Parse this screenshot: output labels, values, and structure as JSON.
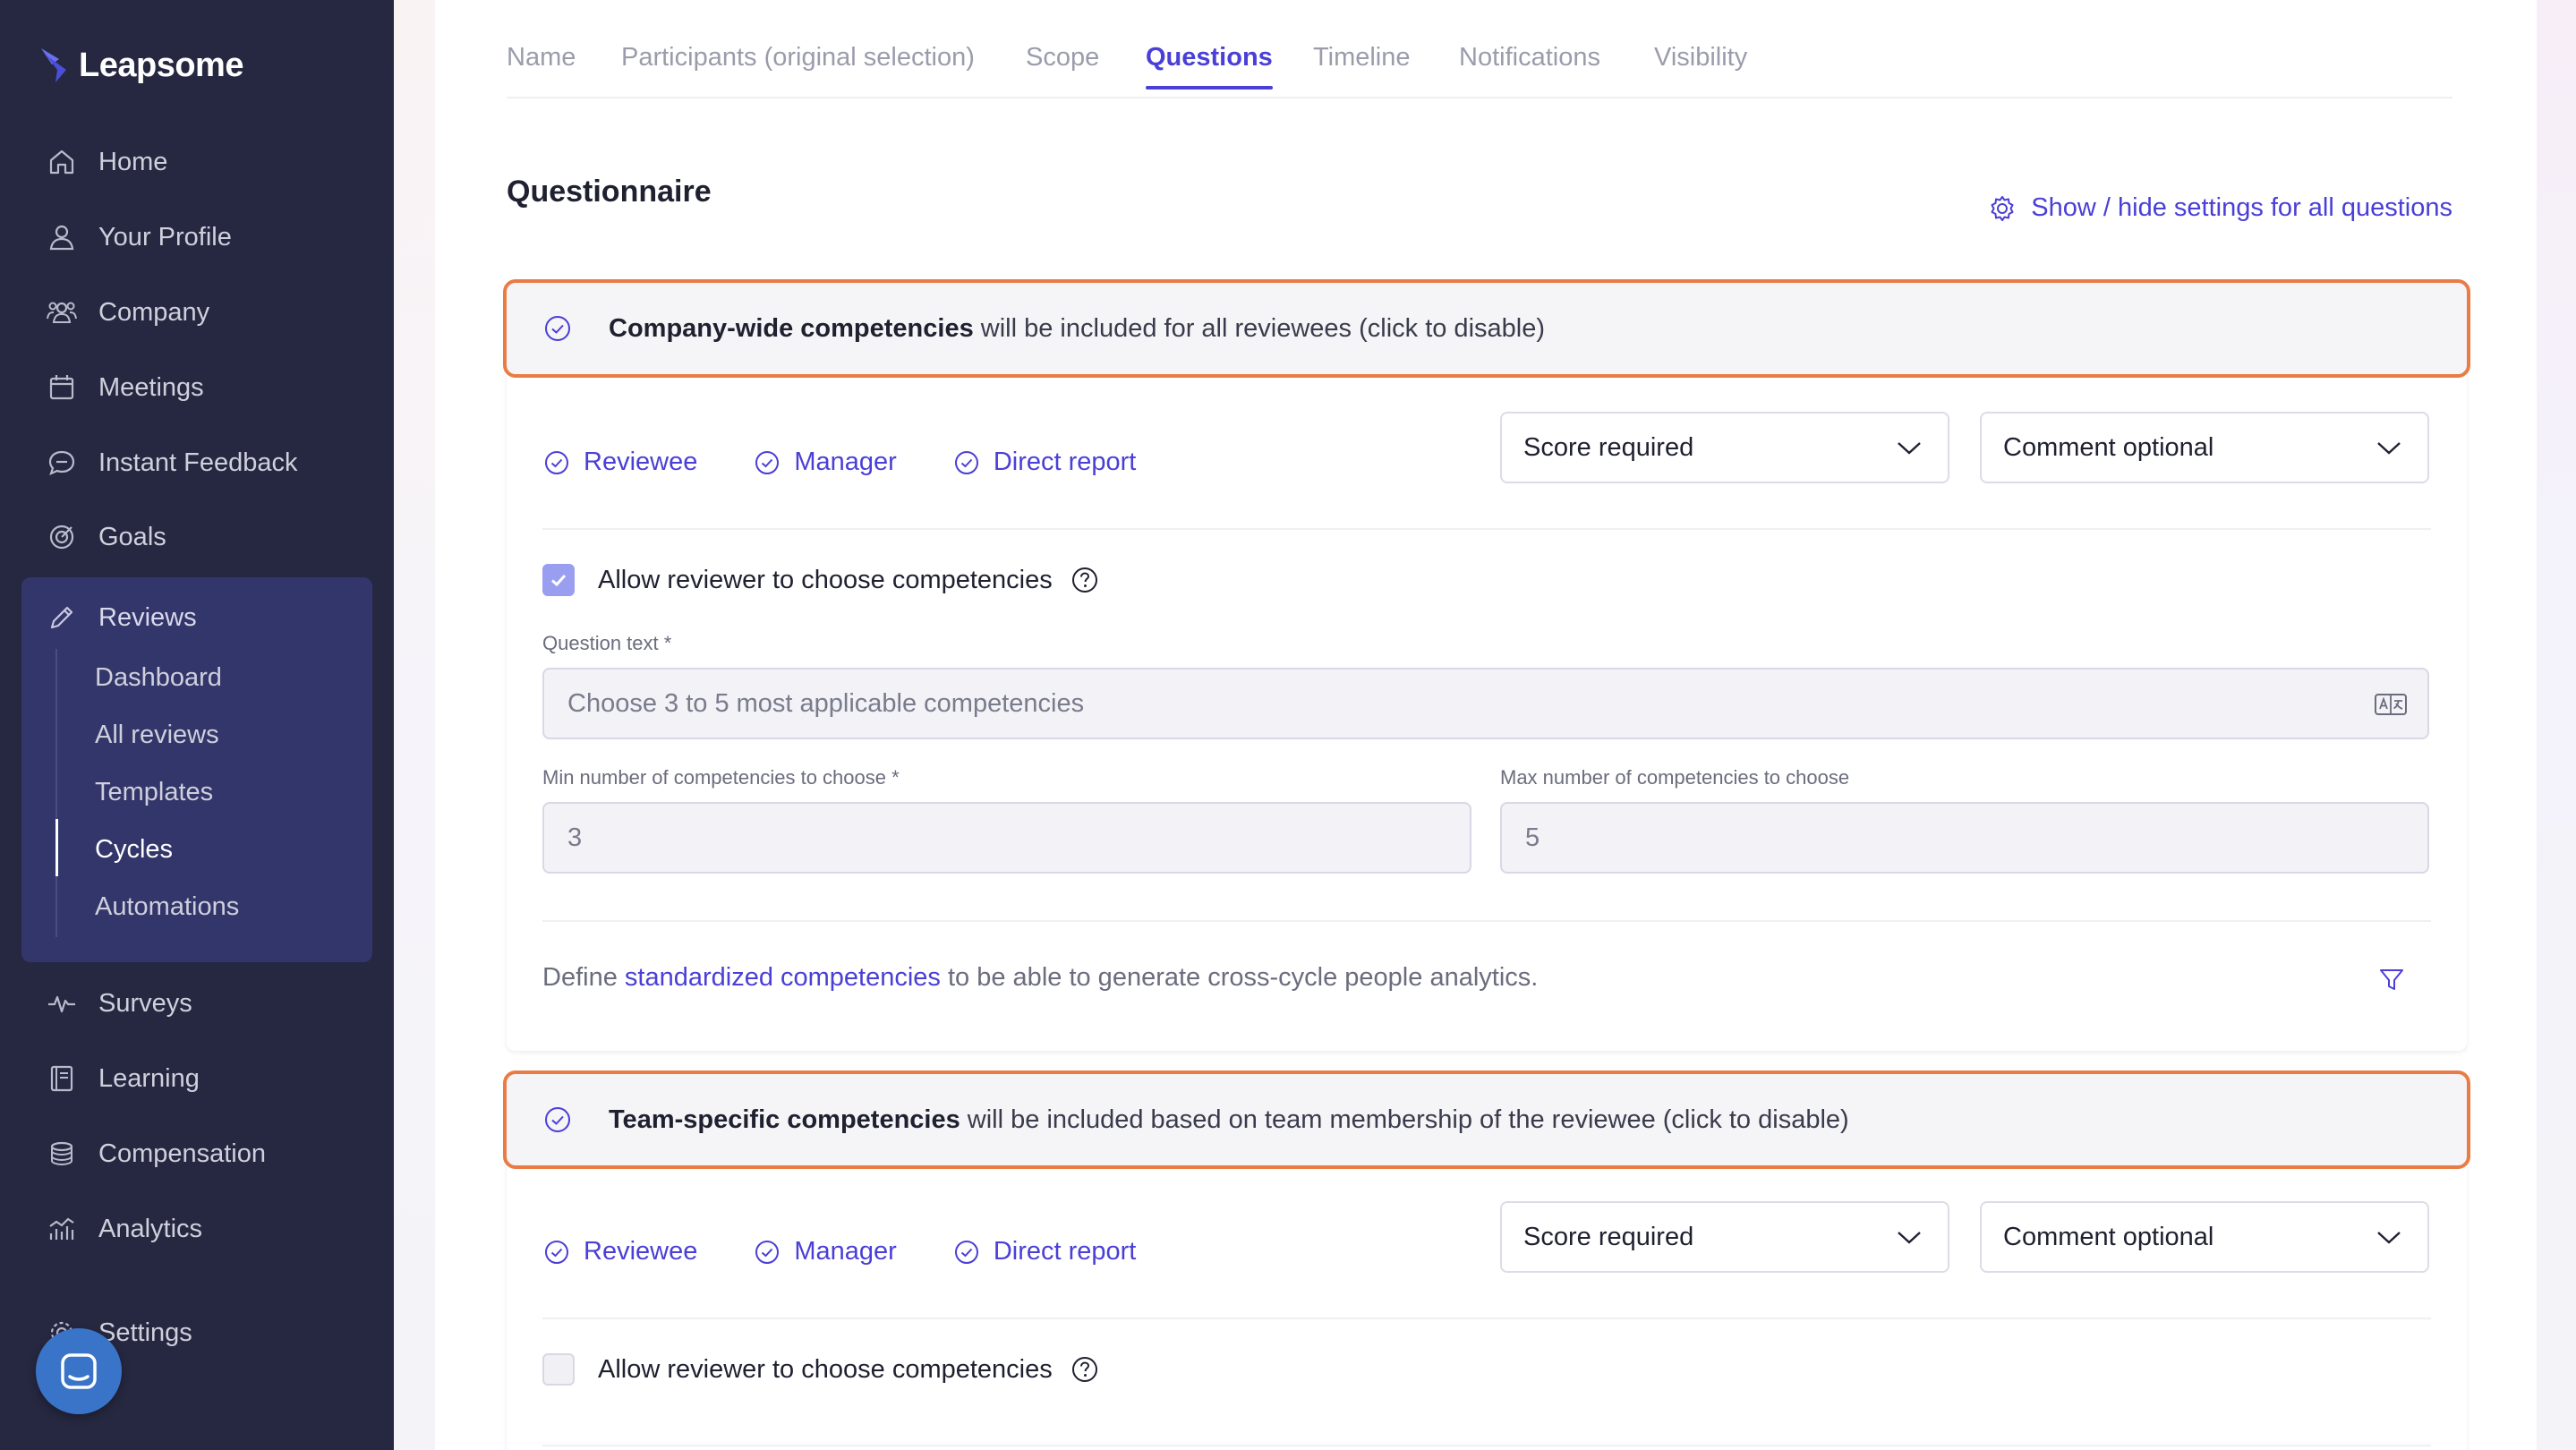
{
  "app": {
    "name": "Leapsome"
  },
  "sidebar": {
    "items": [
      {
        "label": "Home",
        "icon": "home-icon"
      },
      {
        "label": "Your Profile",
        "icon": "user-icon"
      },
      {
        "label": "Company",
        "icon": "company-icon"
      },
      {
        "label": "Meetings",
        "icon": "calendar-icon"
      },
      {
        "label": "Instant Feedback",
        "icon": "chat-icon"
      },
      {
        "label": "Goals",
        "icon": "target-icon"
      },
      {
        "label": "Reviews",
        "icon": "pencil-icon"
      },
      {
        "label": "Surveys",
        "icon": "pulse-icon"
      },
      {
        "label": "Learning",
        "icon": "book-icon"
      },
      {
        "label": "Compensation",
        "icon": "coins-icon"
      },
      {
        "label": "Analytics",
        "icon": "analytics-icon"
      },
      {
        "label": "Settings",
        "icon": "gear-icon"
      }
    ],
    "reviews_sub": [
      {
        "label": "Dashboard"
      },
      {
        "label": "All reviews"
      },
      {
        "label": "Templates"
      },
      {
        "label": "Cycles"
      },
      {
        "label": "Automations"
      }
    ],
    "active_sub": "Cycles"
  },
  "tabs": [
    {
      "label": "Name"
    },
    {
      "label": "Participants (original selection)"
    },
    {
      "label": "Scope"
    },
    {
      "label": "Questions"
    },
    {
      "label": "Timeline"
    },
    {
      "label": "Notifications"
    },
    {
      "label": "Visibility"
    }
  ],
  "active_tab": "Questions",
  "section_title": "Questionnaire",
  "show_hide_label": "Show / hide settings for all questions",
  "blocks": [
    {
      "banner_bold": "Company-wide competencies",
      "banner_rest": "will be included for all reviewees (click to disable)",
      "roles": [
        "Reviewee",
        "Manager",
        "Direct report"
      ],
      "score_select": "Score required",
      "comment_select": "Comment optional",
      "allow_choose_label": "Allow reviewer to choose competencies",
      "allow_choose_checked": true,
      "question_text_label": "Question text *",
      "question_text_value": "Choose 3 to 5 most applicable competencies",
      "min_label": "Min number of competencies to choose *",
      "min_value": "3",
      "max_label": "Max number of competencies to choose",
      "max_value": "5",
      "footer_prefix": "Define",
      "footer_link": "standardized competencies",
      "footer_suffix": "to be able to generate cross-cycle people analytics."
    },
    {
      "banner_bold": "Team-specific competencies",
      "banner_rest": "will be included based on team membership of the reviewee (click to disable)",
      "roles": [
        "Reviewee",
        "Manager",
        "Direct report"
      ],
      "score_select": "Score required",
      "comment_select": "Comment optional",
      "allow_choose_label": "Allow reviewer to choose competencies",
      "allow_choose_checked": false
    }
  ],
  "colors": {
    "accent": "#4a3fd6",
    "highlight_border": "#e97c45",
    "sidebar_bg": "#262841",
    "sidebar_active": "#33366a"
  }
}
